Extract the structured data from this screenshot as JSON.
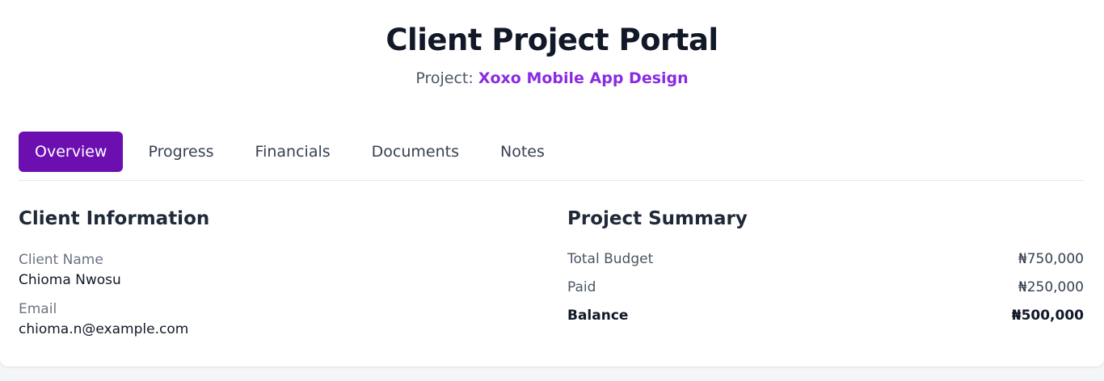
{
  "header": {
    "title": "Client Project Portal",
    "project_prefix": "Project:",
    "project_name": "Xoxo Mobile App Design"
  },
  "tabs": [
    {
      "label": "Overview",
      "active": true
    },
    {
      "label": "Progress",
      "active": false
    },
    {
      "label": "Financials",
      "active": false
    },
    {
      "label": "Documents",
      "active": false
    },
    {
      "label": "Notes",
      "active": false
    }
  ],
  "client_info": {
    "title": "Client Information",
    "name_label": "Client Name",
    "name_value": "Chioma Nwosu",
    "email_label": "Email",
    "email_value": "chioma.n@example.com"
  },
  "project_summary": {
    "title": "Project Summary",
    "rows": [
      {
        "label": "Total Budget",
        "amount": "₦750,000"
      },
      {
        "label": "Paid",
        "amount": "₦250,000"
      },
      {
        "label": "Balance",
        "amount": "₦500,000"
      }
    ]
  },
  "colors": {
    "accent": "#6b0fb0",
    "project_name": "#8a2be2",
    "page_background": "#f4f5f7"
  }
}
